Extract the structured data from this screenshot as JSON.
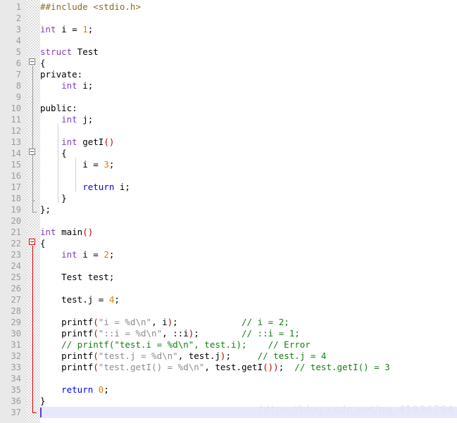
{
  "editor": {
    "language": "C++",
    "watermark": "https://blog.csdn.net/qq_41936794",
    "total_lines": 37,
    "current_line": 37,
    "colors": {
      "background": "#ffffff",
      "gutter": "#e9e9e9",
      "line_number": "#9a9a9a",
      "keyword": "#7f3fbf",
      "keyword_return": "#0000ff",
      "number": "#e08000",
      "preprocessor": "#8a6d1f",
      "string": "#8c8c8c",
      "comment": "#127e12",
      "paren": "#c00000",
      "current_line_highlight": "#e8e8fb",
      "fold_marker_active": "#d00000",
      "cursor": "#5a3fc0"
    }
  },
  "lines": [
    {
      "n": 1,
      "tokens": [
        {
          "t": "##include <stdio.h>",
          "c": "pre"
        }
      ]
    },
    {
      "n": 2,
      "tokens": []
    },
    {
      "n": 3,
      "tokens": [
        {
          "t": "int",
          "c": "kw"
        },
        {
          "t": " i = ",
          "c": "pln"
        },
        {
          "t": "1",
          "c": "num"
        },
        {
          "t": ";",
          "c": "pln"
        }
      ]
    },
    {
      "n": 4,
      "tokens": []
    },
    {
      "n": 5,
      "tokens": [
        {
          "t": "struct",
          "c": "kw"
        },
        {
          "t": " Test",
          "c": "pln"
        }
      ]
    },
    {
      "n": 6,
      "tokens": [
        {
          "t": "{",
          "c": "pln"
        }
      ]
    },
    {
      "n": 7,
      "tokens": [
        {
          "t": "private:",
          "c": "pln"
        }
      ]
    },
    {
      "n": 8,
      "tokens": [
        {
          "t": "    ",
          "c": "pln"
        },
        {
          "t": "int",
          "c": "kw"
        },
        {
          "t": " i;",
          "c": "pln"
        }
      ]
    },
    {
      "n": 9,
      "tokens": []
    },
    {
      "n": 10,
      "tokens": [
        {
          "t": "public:",
          "c": "pln"
        }
      ]
    },
    {
      "n": 11,
      "tokens": [
        {
          "t": "    ",
          "c": "pln"
        },
        {
          "t": "int",
          "c": "kw"
        },
        {
          "t": " j;",
          "c": "pln"
        }
      ]
    },
    {
      "n": 12,
      "tokens": []
    },
    {
      "n": 13,
      "tokens": [
        {
          "t": "    ",
          "c": "pln"
        },
        {
          "t": "int",
          "c": "kw"
        },
        {
          "t": " getI",
          "c": "pln"
        },
        {
          "t": "()",
          "c": "par"
        }
      ]
    },
    {
      "n": 14,
      "tokens": [
        {
          "t": "    {",
          "c": "pln"
        }
      ]
    },
    {
      "n": 15,
      "tokens": [
        {
          "t": "        i = ",
          "c": "pln"
        },
        {
          "t": "3",
          "c": "num"
        },
        {
          "t": ";",
          "c": "pln"
        }
      ]
    },
    {
      "n": 16,
      "tokens": []
    },
    {
      "n": 17,
      "tokens": [
        {
          "t": "        ",
          "c": "pln"
        },
        {
          "t": "return",
          "c": "kw2"
        },
        {
          "t": " i;",
          "c": "pln"
        }
      ]
    },
    {
      "n": 18,
      "tokens": [
        {
          "t": "    }",
          "c": "pln"
        }
      ]
    },
    {
      "n": 19,
      "tokens": [
        {
          "t": "};",
          "c": "pln"
        }
      ]
    },
    {
      "n": 20,
      "tokens": []
    },
    {
      "n": 21,
      "tokens": [
        {
          "t": "int",
          "c": "kw"
        },
        {
          "t": " main",
          "c": "pln"
        },
        {
          "t": "()",
          "c": "par"
        }
      ]
    },
    {
      "n": 22,
      "tokens": [
        {
          "t": "{",
          "c": "pln"
        }
      ]
    },
    {
      "n": 23,
      "tokens": [
        {
          "t": "    ",
          "c": "pln"
        },
        {
          "t": "int",
          "c": "kw"
        },
        {
          "t": " i = ",
          "c": "pln"
        },
        {
          "t": "2",
          "c": "num"
        },
        {
          "t": ";",
          "c": "pln"
        }
      ]
    },
    {
      "n": 24,
      "tokens": []
    },
    {
      "n": 25,
      "tokens": [
        {
          "t": "    Test test;",
          "c": "pln"
        }
      ]
    },
    {
      "n": 26,
      "tokens": []
    },
    {
      "n": 27,
      "tokens": [
        {
          "t": "    test.j = ",
          "c": "pln"
        },
        {
          "t": "4",
          "c": "num"
        },
        {
          "t": ";",
          "c": "pln"
        }
      ]
    },
    {
      "n": 28,
      "tokens": []
    },
    {
      "n": 29,
      "tokens": [
        {
          "t": "    printf",
          "c": "pln"
        },
        {
          "t": "(",
          "c": "par"
        },
        {
          "t": "\"i = %d\\n\"",
          "c": "str"
        },
        {
          "t": ", i",
          "c": "pln"
        },
        {
          "t": ")",
          "c": "par"
        },
        {
          "t": ";",
          "c": "pln"
        },
        {
          "t": "            ",
          "c": "pln"
        },
        {
          "t": "// i = 2;",
          "c": "cmt"
        }
      ]
    },
    {
      "n": 30,
      "tokens": [
        {
          "t": "    printf",
          "c": "pln"
        },
        {
          "t": "(",
          "c": "par"
        },
        {
          "t": "\"::i = %d\\n\"",
          "c": "str"
        },
        {
          "t": ", ::i",
          "c": "pln"
        },
        {
          "t": ")",
          "c": "par"
        },
        {
          "t": ";",
          "c": "pln"
        },
        {
          "t": "        ",
          "c": "pln"
        },
        {
          "t": "// ::i = 1;",
          "c": "cmt"
        }
      ]
    },
    {
      "n": 31,
      "tokens": [
        {
          "t": "    // printf(\"test.i = %d\\n\", test.i);    // Error",
          "c": "cmt"
        }
      ]
    },
    {
      "n": 32,
      "tokens": [
        {
          "t": "    printf",
          "c": "pln"
        },
        {
          "t": "(",
          "c": "par"
        },
        {
          "t": "\"test.j = %d\\n\"",
          "c": "str"
        },
        {
          "t": ", test.j",
          "c": "pln"
        },
        {
          "t": ")",
          "c": "par"
        },
        {
          "t": ";",
          "c": "pln"
        },
        {
          "t": "     ",
          "c": "pln"
        },
        {
          "t": "// test.j = 4",
          "c": "cmt"
        }
      ]
    },
    {
      "n": 33,
      "tokens": [
        {
          "t": "    printf",
          "c": "pln"
        },
        {
          "t": "(",
          "c": "par"
        },
        {
          "t": "\"test.getI() = %d\\n\"",
          "c": "str"
        },
        {
          "t": ", test.getI",
          "c": "pln"
        },
        {
          "t": "()",
          "c": "par"
        },
        {
          "t": ")",
          "c": "par"
        },
        {
          "t": ";",
          "c": "pln"
        },
        {
          "t": "  ",
          "c": "pln"
        },
        {
          "t": "// test.getI() = 3",
          "c": "cmt"
        }
      ]
    },
    {
      "n": 34,
      "tokens": []
    },
    {
      "n": 35,
      "tokens": [
        {
          "t": "    ",
          "c": "pln"
        },
        {
          "t": "return",
          "c": "kw2"
        },
        {
          "t": " ",
          "c": "pln"
        },
        {
          "t": "0",
          "c": "num"
        },
        {
          "t": ";",
          "c": "pln"
        }
      ]
    },
    {
      "n": 36,
      "tokens": [
        {
          "t": "}",
          "c": "pln"
        }
      ]
    },
    {
      "n": 37,
      "tokens": []
    }
  ],
  "fold_markers": [
    {
      "line": 6,
      "state": "expanded",
      "active": false
    },
    {
      "line": 14,
      "state": "expanded",
      "active": false
    },
    {
      "line": 22,
      "state": "expanded",
      "active": true
    }
  ]
}
